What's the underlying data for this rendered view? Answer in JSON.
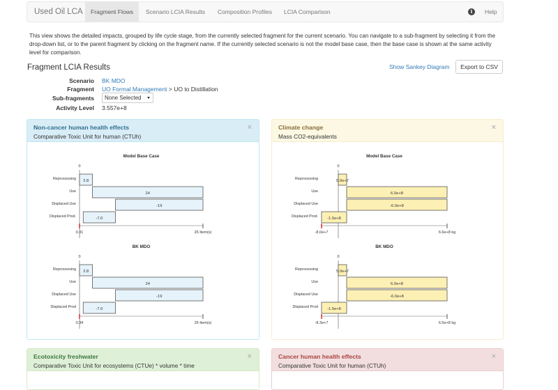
{
  "nav": {
    "brand": "Used Oil LCA",
    "tabs": [
      "Fragment Flows",
      "Scenario LCIA Results",
      "Composition Profiles",
      "LCIA Comparison"
    ],
    "help": "Help"
  },
  "intro": "This view shows the detailed impacts, grouped by life cycle stage, from the currently selected fragment for the current scenario. You can navigate to a sub-fragment by selecting it from the drop-down list, or to the parent fragment by clicking on the fragment name. If the currently selected scenario is not the model base case, then the base case is shown at the same activity level for comparison.",
  "results": {
    "title": "Fragment LCIA Results",
    "sankey_link": "Show Sankey Diagram",
    "export_button": "Export to CSV",
    "labels": {
      "scenario": "Scenario",
      "fragment": "Fragment",
      "subfragments": "Sub-fragments",
      "activity": "Activity Level"
    },
    "scenario": "BK MDO",
    "fragment_link": "UO Formal Management",
    "fragment_suffix": " > UO to Distillation",
    "subfragment_select": "None Selected",
    "activity_level": "3.557e+8"
  },
  "panels": [
    {
      "title": "Non-cancer human health effects",
      "subtitle": "Comparative Toxic Unit for human (CTUh)",
      "close": "×",
      "color": "#d9edf7",
      "bar_fill": "#e6f3fa",
      "charts": [
        {
          "title": "Model Base Case",
          "zero": "0",
          "stages": [
            "Reprocessing",
            "Use",
            "Displaced Use",
            "Displaced Prod."
          ],
          "bar_labels": [
            "2.8",
            "24",
            "-19",
            "-7.0"
          ],
          "axis_min": "0.31",
          "axis_max": "26 Item(s)"
        },
        {
          "title": "BK MDO",
          "zero": "0",
          "stages": [
            "Reprocessing",
            "Use",
            "Displaced Use",
            "Displaced Prod"
          ],
          "bar_labels": [
            "2.8",
            "24",
            "-19",
            "-7.0"
          ],
          "axis_min": "0.34",
          "axis_max": "26 Item(s)"
        }
      ]
    },
    {
      "title": "Climate change",
      "subtitle": "Mass CO2-equivalents",
      "close": "×",
      "color": "#fcf8e3",
      "bar_fill": "#fcf0b4",
      "charts": [
        {
          "title": "Model Base Case",
          "zero": "0",
          "stages": [
            "Reprocessing",
            "Use",
            "Displaced Use",
            "Displaced Prod."
          ],
          "bar_labels": [
            "5.0e+7",
            "6.0e+8",
            "-6.0e+8",
            "-1.5e+8"
          ],
          "axis_min": "-8.0e+7",
          "axis_max": "6.6e+8 kg"
        },
        {
          "title": "BK MDO",
          "zero": "0",
          "stages": [
            "Reprocessing",
            "Use",
            "Displaced Use",
            "Displaced Prod"
          ],
          "bar_labels": [
            "5.0e+7",
            "6.0e+8",
            "-6.0e+8",
            "-1.5e+8"
          ],
          "axis_min": "-8.3e+7",
          "axis_max": "6.5e+8 kg"
        }
      ]
    },
    {
      "title": "Ecotoxicity freshwater",
      "subtitle": "Comparative Toxic Unit for ecosystems (CTUe) * volume * time",
      "close": "×"
    },
    {
      "title": "Cancer human health effects",
      "subtitle": "Comparative Toxic Unit for human (CTUh)",
      "close": "×"
    }
  ],
  "waterfall_values": {
    "ctuh_base": [
      2.8,
      24,
      -19,
      -7.0
    ],
    "ctuh_bk": [
      2.8,
      24,
      -19,
      -7.0
    ],
    "co2_base": [
      50000000.0,
      600000000.0,
      -600000000.0,
      -150000000.0
    ],
    "co2_bk": [
      50000000.0,
      600000000.0,
      -600000000.0,
      -150000000.0
    ]
  }
}
